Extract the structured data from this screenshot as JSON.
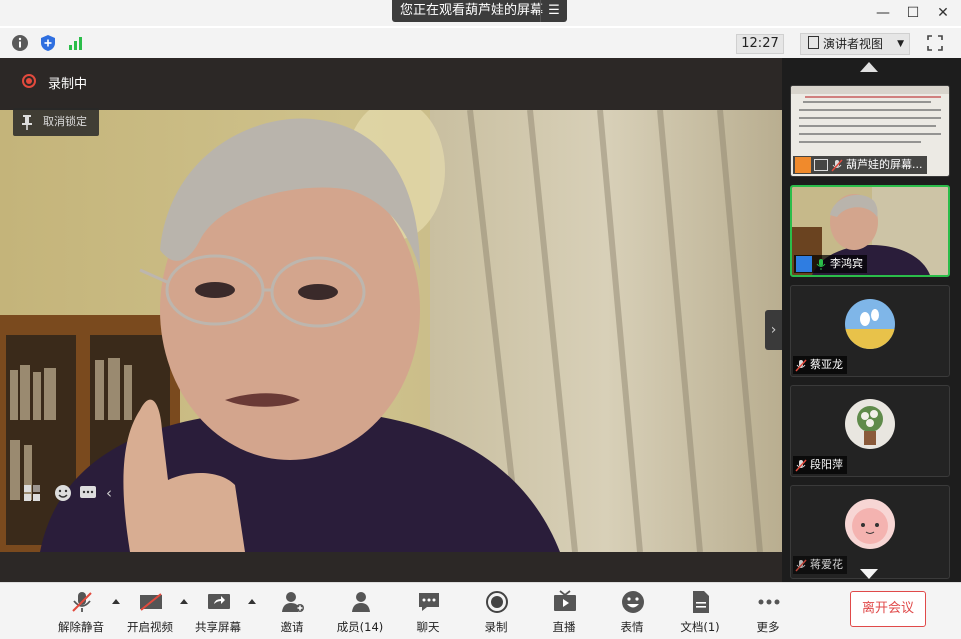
{
  "titlebar": {
    "viewing_text": "您正在观看葫芦娃的屏幕"
  },
  "infobar": {
    "clock": "12:27",
    "view_mode": "演讲者视图"
  },
  "stage": {
    "recording_label": "录制中",
    "unpin_label": "取消锁定"
  },
  "participants": [
    {
      "name": "葫芦娃的屏幕...",
      "kind": "screen-share"
    },
    {
      "name": "李鸿宾",
      "kind": "video",
      "mic": "on"
    },
    {
      "name": "蔡亚龙",
      "kind": "avatar",
      "mic": "off"
    },
    {
      "name": "段阳萍",
      "kind": "avatar",
      "mic": "off"
    },
    {
      "name": "蒋爱花",
      "kind": "avatar",
      "mic": "off"
    }
  ],
  "toolbar": {
    "unmute": "解除静音",
    "start_video": "开启视频",
    "share_screen": "共享屏幕",
    "invite": "邀请",
    "members": "成员(14)",
    "chat": "聊天",
    "record": "录制",
    "live": "直播",
    "reactions": "表情",
    "docs": "文档(1)",
    "more": "更多",
    "leave": "离开会议"
  },
  "colors": {
    "accent_green": "#2bbd4a",
    "record_red": "#e24a3d",
    "leave_red": "#e04a4a"
  }
}
